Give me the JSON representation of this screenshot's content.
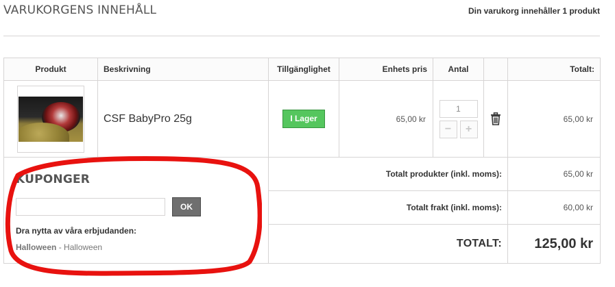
{
  "header": {
    "title": "VARUKORGENS INNEHÅLL",
    "cart_summary": "Din varukorg innehåller 1 produkt"
  },
  "table": {
    "columns": {
      "product": "Produkt",
      "description": "Beskrivning",
      "availability": "Tillgänglighet",
      "unit_price": "Enhets pris",
      "quantity": "Antal",
      "total": "Totalt:"
    },
    "item": {
      "name": "CSF BabyPro 25g",
      "availability": "I Lager",
      "unit_price": "65,00 kr",
      "quantity": "1",
      "decrease_symbol": "−",
      "increase_symbol": "+",
      "total": "65,00 kr"
    },
    "totals": {
      "products_label": "Totalt produkter (inkl. moms):",
      "products_value": "65,00 kr",
      "shipping_label": "Totalt frakt (inkl. moms):",
      "shipping_value": "60,00 kr",
      "grand_label": "TOTALT:",
      "grand_value": "125,00 kr"
    }
  },
  "voucher": {
    "title": "KUPONGER",
    "input_value": "",
    "ok_label": "OK",
    "offers_title": "Dra nytta av våra erbjudanden:",
    "offer_code": "Halloween",
    "offer_separator": " - ",
    "offer_name": "Halloween"
  },
  "colors": {
    "stock_badge": "#55c65e",
    "annotation": "#e8120f",
    "ok_button": "#6f6f6f",
    "border": "#d6d4d4"
  },
  "icons": {
    "delete": "trash-icon"
  }
}
